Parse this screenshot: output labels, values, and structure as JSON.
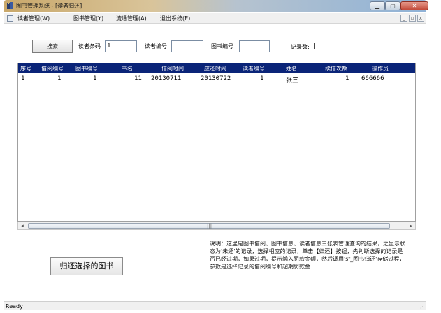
{
  "window": {
    "title": "图书管理系统 - [读者归还]"
  },
  "menu": {
    "items": [
      "读者管理(W)",
      "图书管理(Y)",
      "流通管理(A)",
      "退出系统(E)"
    ]
  },
  "search": {
    "button_label": "搜索",
    "reader_barcode_label": "读者条码",
    "reader_barcode_value": "1",
    "reader_id_label": "读者编号",
    "reader_id_value": "",
    "book_id_label": "图书编号",
    "book_id_value": "",
    "record_count_label": "记录数:",
    "record_count_value": "|"
  },
  "table": {
    "columns": [
      "序号",
      "借阅编号",
      "图书编号",
      "书名",
      "借阅时间",
      "应还时间",
      "读者编号",
      "姓名",
      "续借次数",
      "操作员"
    ],
    "rows": [
      [
        "1",
        "1",
        "1",
        "11",
        "20130711",
        "20130722",
        "1",
        "张三",
        "1",
        "666666"
      ]
    ]
  },
  "scrollbar": {
    "left_arrow": "◂",
    "right_arrow": "▸",
    "grip": "|||"
  },
  "actions": {
    "return_button_label": "归还选择的图书"
  },
  "note": {
    "text": "说明：这里是图书借阅、图书信息、读者信息三张表管理查询的结果，之显示状态为'未还'的记录，选择相应的记录，单击【归还】按钮，先判断选择的记录是否已经过期，如果过期，提示输入罚款金额，然后调用'sf_图书归还'存储过程，参数是选择记录的借阅编号和超期罚款金"
  },
  "status": {
    "text": "Ready"
  },
  "colors": {
    "grid_header_bg": "#0a2478",
    "grid_header_fg": "#ffffff"
  }
}
